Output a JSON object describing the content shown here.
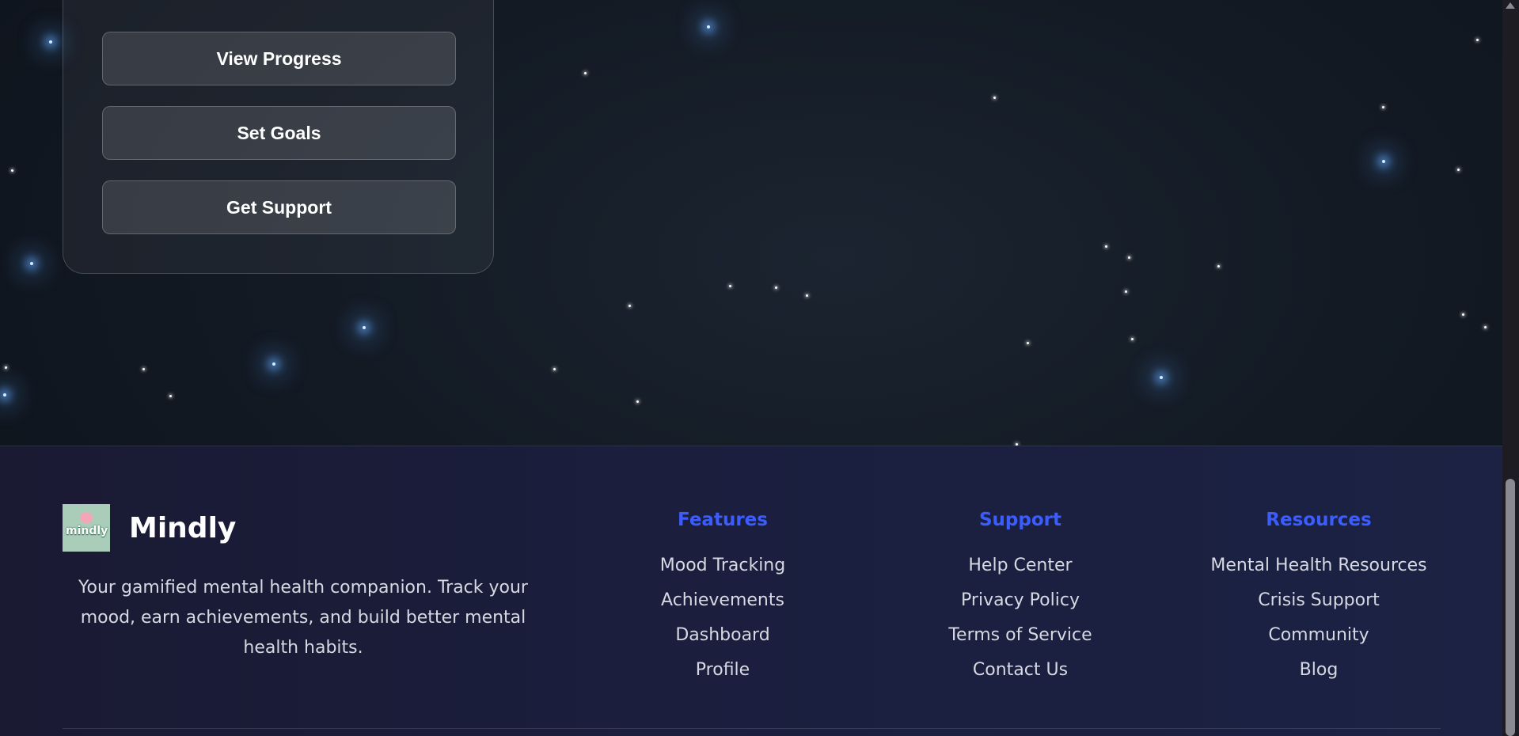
{
  "actions": {
    "buttons": [
      {
        "label": "View Progress"
      },
      {
        "label": "Set Goals"
      },
      {
        "label": "Get Support"
      }
    ]
  },
  "footer": {
    "brand": {
      "logo_text": "mindly",
      "name": "Mindly",
      "tagline": "Your gamified mental health companion. Track your mood, earn achievements, and build better mental health habits."
    },
    "columns": [
      {
        "title": "Features",
        "links": [
          "Mood Tracking",
          "Achievements",
          "Dashboard",
          "Profile"
        ]
      },
      {
        "title": "Support",
        "links": [
          "Help Center",
          "Privacy Policy",
          "Terms of Service",
          "Contact Us"
        ]
      },
      {
        "title": "Resources",
        "links": [
          "Mental Health Resources",
          "Crisis Support",
          "Community",
          "Blog"
        ]
      }
    ]
  },
  "colors": {
    "accent": "#3b5cff",
    "background": "#131a24",
    "footer_background": "#1b1f3f",
    "star_glow": "#60a5fa"
  }
}
